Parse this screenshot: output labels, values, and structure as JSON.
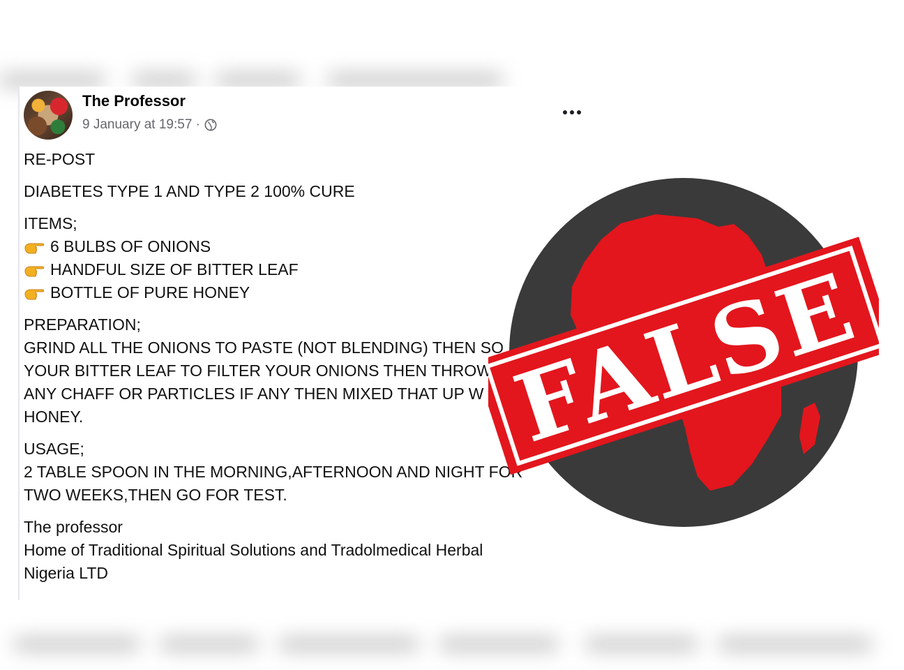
{
  "post": {
    "author": "The Professor",
    "timestamp": "9 January at 19:57 ·",
    "audience_icon": "globe-icon",
    "more_icon": "more-options-icon",
    "repost": "RE-POST",
    "headline": "DIABETES TYPE 1 AND TYPE 2 100% CURE",
    "items_heading": "ITEMS;",
    "bullet_icon": "pointing-finger-icon",
    "items": [
      "6 BULBS OF ONIONS",
      "HANDFUL SIZE OF BITTER LEAF",
      "BOTTLE OF PURE HONEY"
    ],
    "preparation_heading": "PREPARATION;",
    "preparation_lines": [
      "GRIND ALL THE ONIONS TO PASTE (NOT BLENDING) THEN SO",
      "YOUR BITTER LEAF TO FILTER YOUR ONIONS THEN THROW",
      "ANY CHAFF OR PARTICLES IF ANY THEN MIXED THAT UP W",
      "HONEY."
    ],
    "usage_heading": "USAGE;",
    "usage_lines": [
      "2 TABLE SPOON IN THE MORNING,AFTERNOON AND NIGHT FOR",
      "TWO WEEKS,THEN GO FOR TEST."
    ],
    "signature_lines": [
      "The professor",
      "Home of Traditional Spiritual Solutions and Tradolmedical Herbal",
      "Nigeria LTD"
    ]
  },
  "stamp": {
    "label": "FALSE",
    "icon": "africa-map-icon",
    "band_color": "#e3161d",
    "disc_color": "#3a3a3a",
    "map_color": "#e3161d"
  }
}
